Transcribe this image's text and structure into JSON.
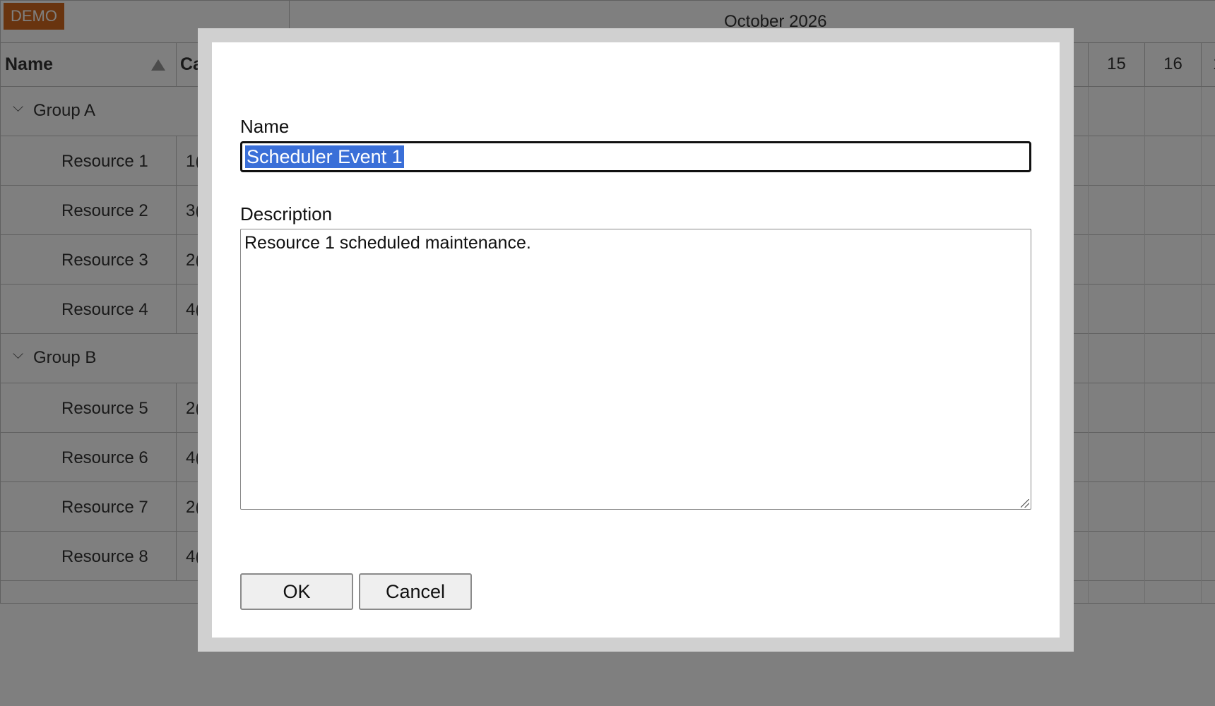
{
  "demo_badge": "DEMO",
  "calendar": {
    "month_label": "October 2026",
    "columns": {
      "name": "Name",
      "capacity": "Ca"
    },
    "visible_days": [
      "15",
      "16",
      "1"
    ]
  },
  "groups": [
    {
      "label": "Group A",
      "resources": [
        {
          "name": "Resource 1",
          "capacity": "1("
        },
        {
          "name": "Resource 2",
          "capacity": "3("
        },
        {
          "name": "Resource 3",
          "capacity": "2("
        },
        {
          "name": "Resource 4",
          "capacity": "4("
        }
      ]
    },
    {
      "label": "Group B",
      "resources": [
        {
          "name": "Resource 5",
          "capacity": "2("
        },
        {
          "name": "Resource 6",
          "capacity": "4("
        },
        {
          "name": "Resource 7",
          "capacity": "2("
        },
        {
          "name": "Resource 8",
          "capacity": "4("
        }
      ]
    }
  ],
  "modal": {
    "name_label": "Name",
    "name_value": "Scheduler Event 1",
    "description_label": "Description",
    "description_value": "Resource 1 scheduled maintenance.",
    "ok_label": "OK",
    "cancel_label": "Cancel"
  },
  "colors": {
    "demo_badge": "#d2691e",
    "selection": "#3a6fd8",
    "modal_frame": "#d0d0d0",
    "overlay": "rgba(0,0,0,0.5)"
  }
}
